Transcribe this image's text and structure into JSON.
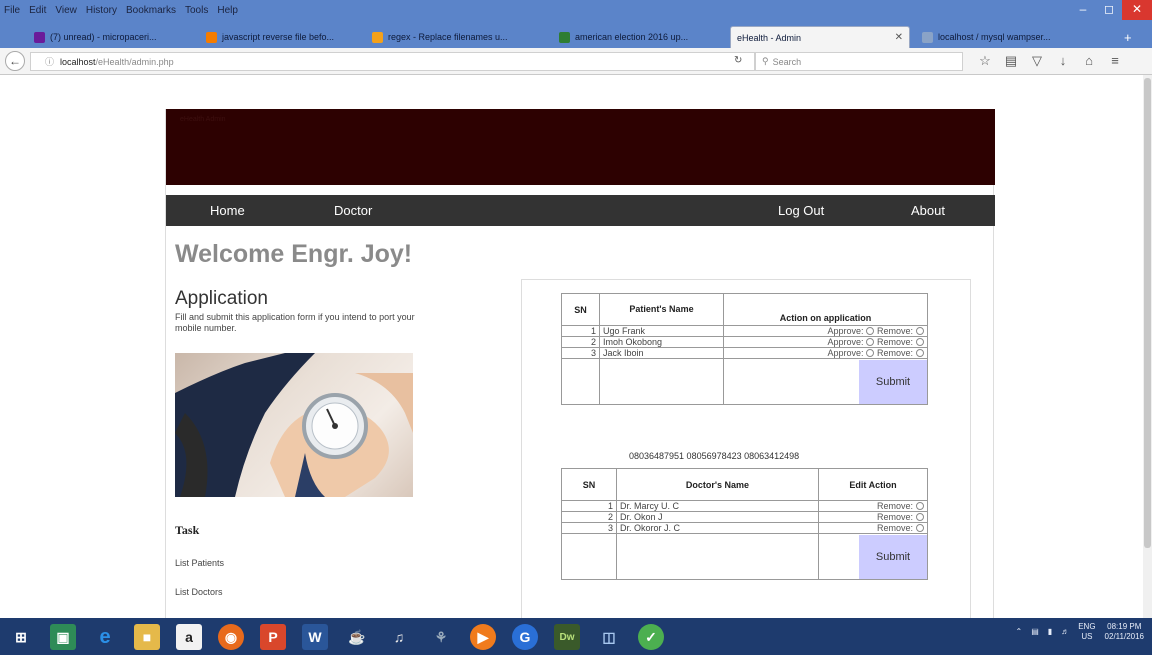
{
  "browser": {
    "menu": [
      "File",
      "Edit",
      "View",
      "History",
      "Bookmarks",
      "Tools",
      "Help"
    ],
    "tabs": [
      {
        "title": "(7) unread) - micropaceri...",
        "color": "#6a1b9a"
      },
      {
        "title": "javascript reverse file befo...",
        "color": "#f57c00"
      },
      {
        "title": "regex - Replace filenames u...",
        "color": "#f4a11b"
      },
      {
        "title": "american election 2016 up...",
        "color": "#2e7d32"
      },
      {
        "title": "eHealth - Admin",
        "color": "#ffffff",
        "active": true
      },
      {
        "title": "localhost / mysql wampser...",
        "color": "#8aa3c7"
      }
    ],
    "url_host": "localhost",
    "url_path": "/eHealth/admin.php",
    "search_placeholder": "Search"
  },
  "site": {
    "banner_text": "eHealth Admin",
    "nav": {
      "home": "Home",
      "doctor": "Doctor",
      "logout": "Log Out",
      "about": "About"
    },
    "welcome": "Welcome Engr. Joy!",
    "application_title": "Application",
    "application_desc": "Fill and submit this application form if you intend to port your mobile number.",
    "task_title": "Task",
    "task_links": [
      "List Patients",
      "List Doctors"
    ]
  },
  "patients_table": {
    "headers": {
      "sn": "SN",
      "name": "Patient's Name",
      "action": "Action on application"
    },
    "rows": [
      {
        "sn": "1",
        "name": "Ugo Frank"
      },
      {
        "sn": "2",
        "name": "Imoh Okobong"
      },
      {
        "sn": "3",
        "name": "Jack Iboin"
      }
    ],
    "approve_label": "Approve:",
    "remove_label": "Remove:",
    "submit_label": "Submit"
  },
  "phone_numbers": "08036487951 08056978423 08063412498",
  "doctors_table": {
    "headers": {
      "sn": "SN",
      "name": "Doctor's Name",
      "action": "Edit Action"
    },
    "rows": [
      {
        "sn": "1",
        "name": "Dr. Marcy U. C"
      },
      {
        "sn": "2",
        "name": "Dr. Okon J"
      },
      {
        "sn": "3",
        "name": "Dr. Okoror J. C"
      }
    ],
    "remove_label": "Remove:",
    "submit_label": "Submit"
  },
  "taskbar": {
    "lang": "ENG",
    "region": "US",
    "time": "08:19 PM",
    "date": "02/11/2016"
  }
}
